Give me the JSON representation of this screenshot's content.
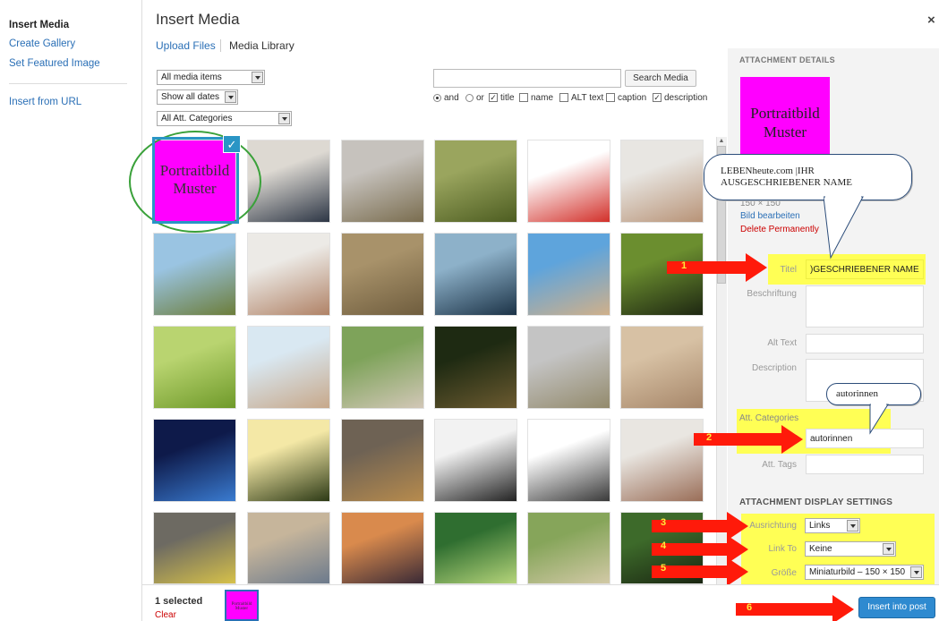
{
  "left_menu": {
    "insert_media": "Insert Media",
    "create_gallery": "Create Gallery",
    "set_featured": "Set Featured Image",
    "insert_url": "Insert from URL"
  },
  "header": {
    "title": "Insert Media",
    "close": "×",
    "tab_upload": "Upload Files",
    "tab_library": "Media Library"
  },
  "filters": {
    "media_items": "All media items",
    "dates": "Show all dates",
    "categories": "All Att. Categories",
    "search_button": "Search Media",
    "opt_and": "and",
    "opt_or": "or",
    "opt_title": "title",
    "opt_name": "name",
    "opt_alt": "ALT text",
    "opt_caption": "caption",
    "opt_description": "description",
    "search_value": ""
  },
  "grid": {
    "selected_label": "Portraitbild Muster",
    "thumbs": [
      {
        "colors": [
          "#ff00ff",
          "#ff00ff"
        ]
      },
      {
        "colors": [
          "#ddd9d2",
          "#2d3645"
        ]
      },
      {
        "colors": [
          "#c6c2bd",
          "#7a6d4f"
        ]
      },
      {
        "colors": [
          "#9aa55e",
          "#4d5d21"
        ]
      },
      {
        "colors": [
          "#ffffff",
          "#d2302a"
        ]
      },
      {
        "colors": [
          "#e8e6e2",
          "#b89377"
        ]
      },
      {
        "colors": [
          "#9ac4e2",
          "#6c7d3a"
        ]
      },
      {
        "colors": [
          "#eceae6",
          "#b08266"
        ]
      },
      {
        "colors": [
          "#a8926a",
          "#6f5d3e"
        ]
      },
      {
        "colors": [
          "#8db1c9",
          "#1c3347"
        ]
      },
      {
        "colors": [
          "#5ea4dc",
          "#d0b08a"
        ]
      },
      {
        "colors": [
          "#6b8e2f",
          "#1e2712"
        ]
      },
      {
        "colors": [
          "#b9d470",
          "#6f9a2a"
        ]
      },
      {
        "colors": [
          "#d9e8f2",
          "#c7a88a"
        ]
      },
      {
        "colors": [
          "#7ea35a",
          "#d2c7b7"
        ]
      },
      {
        "colors": [
          "#1e2a12",
          "#6b5a30"
        ]
      },
      {
        "colors": [
          "#c4c4c4",
          "#938a6c"
        ]
      },
      {
        "colors": [
          "#d7c1a4",
          "#a7876a"
        ]
      },
      {
        "colors": [
          "#0e1a4a",
          "#3a7bd0"
        ]
      },
      {
        "colors": [
          "#f4e8a6",
          "#2d3a16"
        ]
      },
      {
        "colors": [
          "#6e6254",
          "#b78b4d"
        ]
      },
      {
        "colors": [
          "#f2f2f2",
          "#232323"
        ]
      },
      {
        "colors": [
          "#ffffff",
          "#3a3a3a"
        ]
      },
      {
        "colors": [
          "#e9e6e1",
          "#9a6e58"
        ]
      },
      {
        "colors": [
          "#6d6a62",
          "#d6c14a"
        ]
      },
      {
        "colors": [
          "#c6b59b",
          "#6c7a8c"
        ]
      },
      {
        "colors": [
          "#d98a4d",
          "#3a2a36"
        ]
      },
      {
        "colors": [
          "#2f6e30",
          "#b5d47a"
        ]
      },
      {
        "colors": [
          "#86a55a",
          "#d2c9a6"
        ]
      },
      {
        "colors": [
          "#3d6a2a",
          "#1a2612"
        ]
      }
    ]
  },
  "sidebar": {
    "heading": "ATTACHMENT DETAILS",
    "thumb_label": "Portraitbild Muster",
    "size": "150 × 150",
    "edit": "Bild bearbeiten",
    "delete": "Delete Permanently",
    "label_title": "Titel",
    "value_title": ")GESCHRIEBENER NAME",
    "label_caption": "Beschriftung",
    "label_alt": "Alt Text",
    "label_description": "Description",
    "label_categories": "Att. Categories",
    "value_categories": "autorinnen",
    "label_tags": "Att. Tags",
    "display_heading": "ATTACHMENT DISPLAY SETTINGS",
    "label_align": "Ausrichtung",
    "value_align": "Links",
    "label_link": "Link To",
    "value_link": "Keine",
    "label_size": "Größe",
    "value_size": "Miniaturbild – 150 × 150"
  },
  "callouts": {
    "bubble1": "LEBENheute.com |IHR AUSGESCHRIEBENER NAME",
    "bubble2": "autorinnen",
    "n1": "1",
    "n2": "2",
    "n3": "3",
    "n4": "4",
    "n5": "5",
    "n6": "6"
  },
  "footer": {
    "selected": "1 selected",
    "clear": "Clear",
    "thumb_label": "Portraitbild Muster",
    "insert": "Insert into post"
  },
  "colors": {
    "accent": "#2a6fb6",
    "highlight": "#ffff55",
    "arrow": "#ff1a0a",
    "selected_media": "#ff00ff",
    "primary_button": "#2e8ad0"
  }
}
